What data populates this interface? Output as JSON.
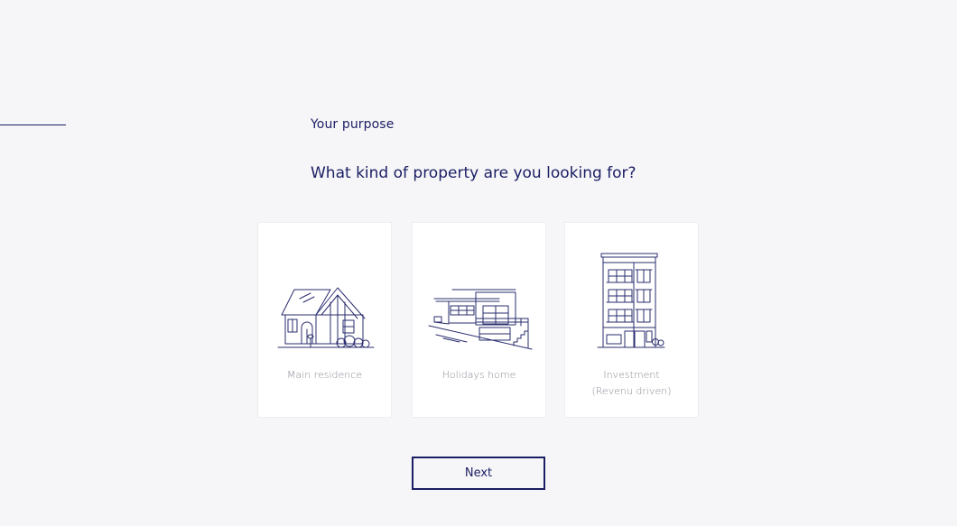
{
  "header": {
    "step_label": "Your purpose",
    "question": "What kind of property are you looking for?"
  },
  "options": [
    {
      "label": "Main residence",
      "icon": "house-icon"
    },
    {
      "label": "Holidays home",
      "icon": "modern-house-icon"
    },
    {
      "label_line1": "Investment",
      "label_line2": "(Revenu driven)",
      "icon": "apartment-building-icon"
    }
  ],
  "actions": {
    "next_label": "Next"
  },
  "colors": {
    "accent": "#1b1e63",
    "background": "#f6f6f8",
    "card": "#ffffff",
    "muted_text": "#8a8c96"
  }
}
